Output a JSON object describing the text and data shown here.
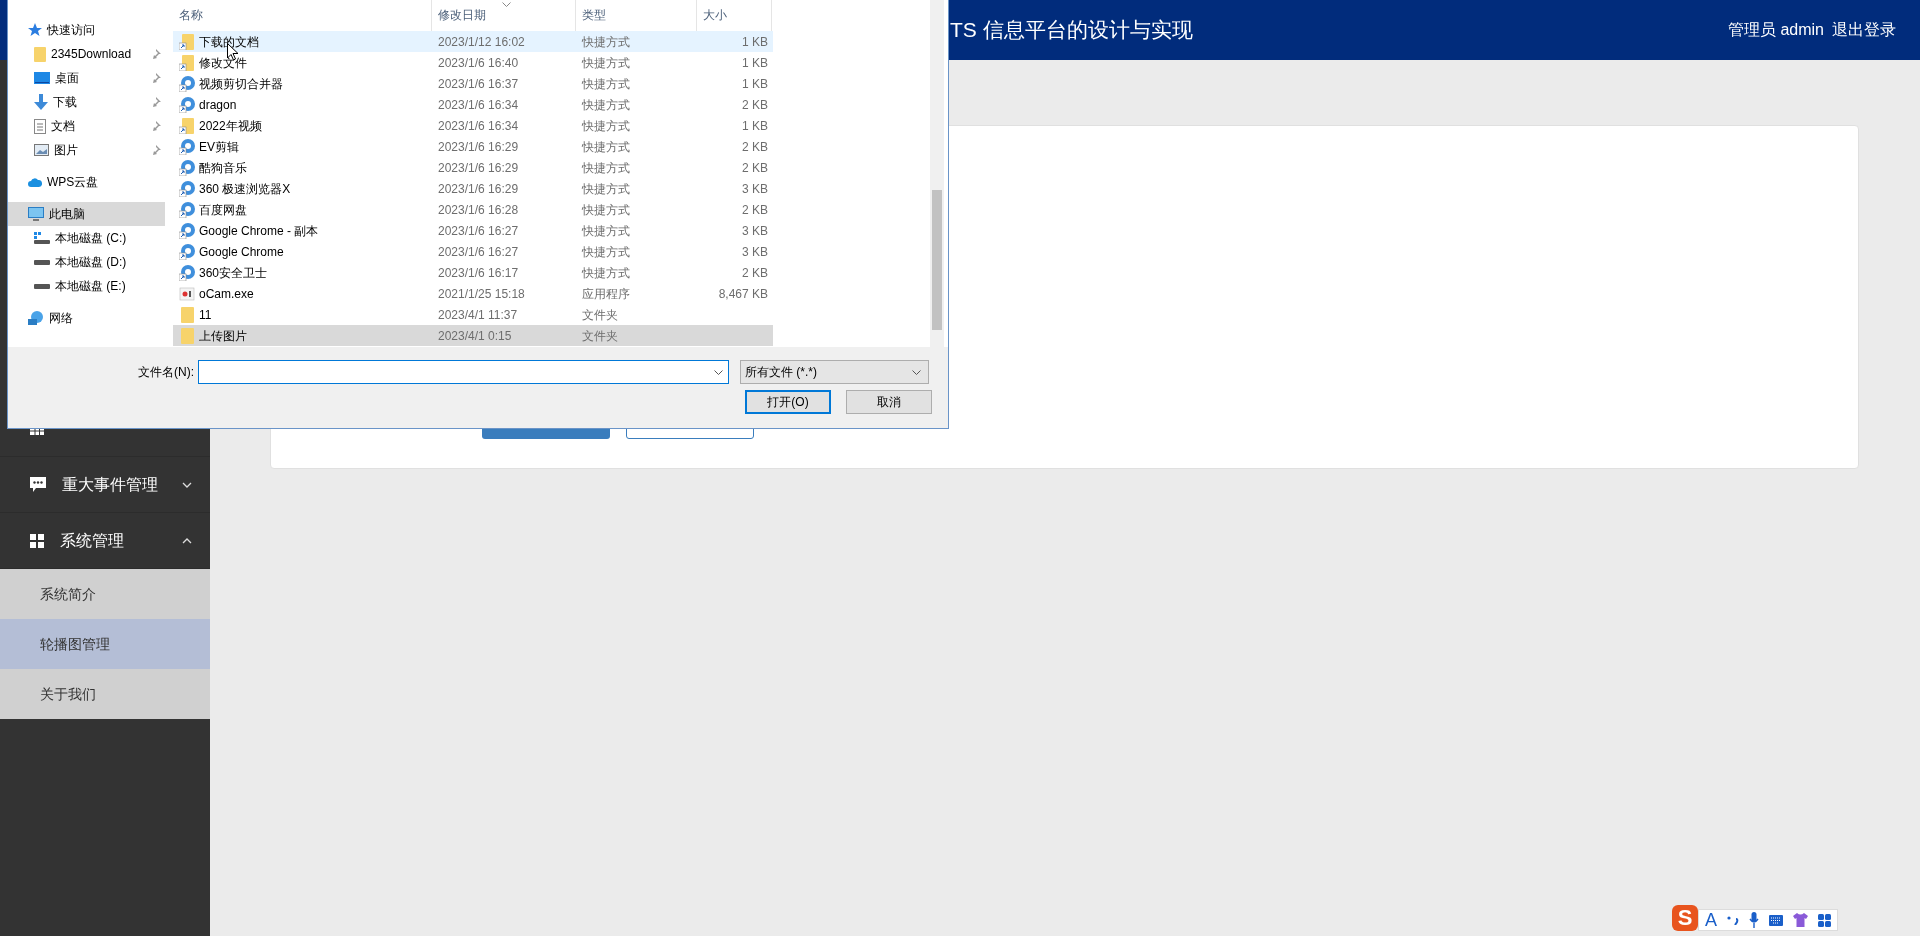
{
  "header": {
    "title": "TS 信息平台的设计与实现",
    "user": "管理员 admin",
    "logout": "退出登录"
  },
  "sidebar": [
    {
      "kind": "table"
    },
    {
      "label": "重大事件管理",
      "kind": "comment",
      "expanded": false
    },
    {
      "label": "系统管理",
      "kind": "apps",
      "expanded": true,
      "children": [
        {
          "label": "系统简介",
          "selected": false
        },
        {
          "label": "轮播图管理",
          "selected": true
        },
        {
          "label": "关于我们",
          "selected": false
        }
      ]
    }
  ],
  "dialog": {
    "nav": [
      {
        "label": "快速访问",
        "kind": "star",
        "selected": false,
        "children": [
          {
            "label": "2345Download",
            "kind": "folder",
            "pinned": true,
            "selected": false
          },
          {
            "label": "桌面",
            "kind": "desktop",
            "pinned": true,
            "selected": false
          },
          {
            "label": "下载",
            "kind": "download",
            "pinned": true,
            "selected": false
          },
          {
            "label": "文档",
            "kind": "document",
            "pinned": true,
            "selected": false
          },
          {
            "label": "图片",
            "kind": "picture",
            "pinned": true,
            "selected": false
          }
        ]
      },
      {
        "label": "WPS云盘",
        "kind": "cloud",
        "selected": false
      },
      {
        "label": "此电脑",
        "kind": "pc",
        "selected": true,
        "children": [
          {
            "label": "本地磁盘 (C:)",
            "kind": "drive_system",
            "selected": false
          },
          {
            "label": "本地磁盘 (D:)",
            "kind": "drive",
            "selected": false
          },
          {
            "label": "本地磁盘 (E:)",
            "kind": "drive",
            "selected": false
          }
        ]
      },
      {
        "label": "网络",
        "kind": "network",
        "selected": false
      }
    ],
    "columns": [
      {
        "label": "名称",
        "sorted": false
      },
      {
        "label": "修改日期",
        "sorted": true
      },
      {
        "label": "类型",
        "sorted": false
      },
      {
        "label": "大小",
        "sorted": false
      }
    ],
    "files": [
      {
        "name": "下载的文档",
        "date": "2023/1/12 16:02",
        "type": "快捷方式",
        "size": "1 KB",
        "kind": "folder_shortcut",
        "hovered": true,
        "selected": false
      },
      {
        "name": "修改文件",
        "date": "2023/1/6 16:40",
        "type": "快捷方式",
        "size": "1 KB",
        "kind": "folder_shortcut",
        "hovered": false,
        "selected": false
      },
      {
        "name": "视频剪切合并器",
        "date": "2023/1/6 16:37",
        "type": "快捷方式",
        "size": "1 KB",
        "kind": "app_shortcut",
        "hovered": false,
        "selected": false
      },
      {
        "name": "dragon",
        "date": "2023/1/6 16:34",
        "type": "快捷方式",
        "size": "2 KB",
        "kind": "app_shortcut",
        "hovered": false,
        "selected": false
      },
      {
        "name": "2022年视频",
        "date": "2023/1/6 16:34",
        "type": "快捷方式",
        "size": "1 KB",
        "kind": "folder_shortcut",
        "hovered": false,
        "selected": false
      },
      {
        "name": "EV剪辑",
        "date": "2023/1/6 16:29",
        "type": "快捷方式",
        "size": "2 KB",
        "kind": "app_shortcut",
        "hovered": false,
        "selected": false
      },
      {
        "name": "酷狗音乐",
        "date": "2023/1/6 16:29",
        "type": "快捷方式",
        "size": "2 KB",
        "kind": "app_shortcut",
        "hovered": false,
        "selected": false
      },
      {
        "name": "360 极速浏览器X",
        "date": "2023/1/6 16:29",
        "type": "快捷方式",
        "size": "3 KB",
        "kind": "app_shortcut",
        "hovered": false,
        "selected": false
      },
      {
        "name": "百度网盘",
        "date": "2023/1/6 16:28",
        "type": "快捷方式",
        "size": "2 KB",
        "kind": "app_shortcut",
        "hovered": false,
        "selected": false
      },
      {
        "name": "Google Chrome - 副本",
        "date": "2023/1/6 16:27",
        "type": "快捷方式",
        "size": "3 KB",
        "kind": "app_shortcut",
        "hovered": false,
        "selected": false
      },
      {
        "name": "Google Chrome",
        "date": "2023/1/6 16:27",
        "type": "快捷方式",
        "size": "3 KB",
        "kind": "app_shortcut",
        "hovered": false,
        "selected": false
      },
      {
        "name": "360安全卫士",
        "date": "2023/1/6 16:17",
        "type": "快捷方式",
        "size": "2 KB",
        "kind": "app_shortcut",
        "hovered": false,
        "selected": false
      },
      {
        "name": "oCam.exe",
        "date": "2021/1/25 15:18",
        "type": "应用程序",
        "size": "8,467 KB",
        "kind": "program",
        "hovered": false,
        "selected": false
      },
      {
        "name": "11",
        "date": "2023/4/1 11:37",
        "type": "文件夹",
        "kind": "folder",
        "hovered": false,
        "selected": false
      },
      {
        "name": "上传图片",
        "date": "2023/4/1 0:15",
        "type": "文件夹",
        "kind": "folder",
        "hovered": false,
        "selected": true
      }
    ],
    "filename": {
      "label": "文件名(N):"
    },
    "filter": "所有文件 (*.*)",
    "buttons": [
      {
        "label": "打开(O)",
        "kind": "default"
      },
      {
        "label": "取消",
        "kind": "normal"
      }
    ]
  },
  "ime": {
    "logo": "S",
    "mode": "A"
  }
}
